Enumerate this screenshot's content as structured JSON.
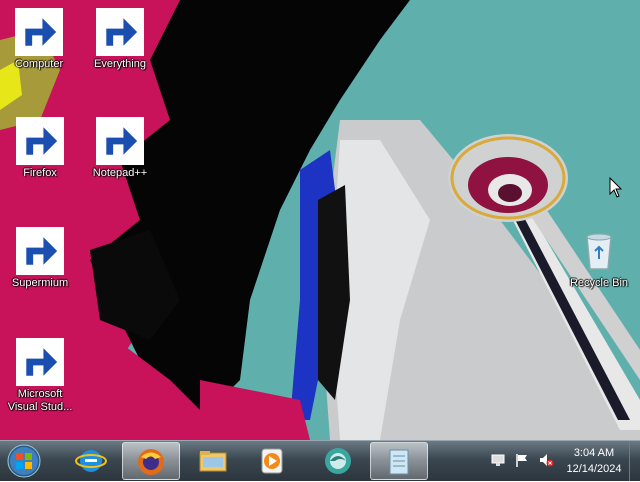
{
  "desktop": {
    "icons": [
      {
        "label": "Computer",
        "icon": "computer-icon"
      },
      {
        "label": "Everything",
        "icon": "everything-icon"
      },
      {
        "label": "Firefox",
        "icon": "firefox-icon"
      },
      {
        "label": "Notepad++",
        "icon": "notepad-plus-plus-icon"
      },
      {
        "label": "Supermium",
        "icon": "supermium-icon"
      },
      {
        "label": "Microsoft\nVisual Stud...",
        "icon": "visual-studio-icon"
      },
      {
        "label": "Recycle Bin",
        "icon": "recycle-bin-icon"
      }
    ]
  },
  "taskbar": {
    "start_icon": "windows-start-icon",
    "pinned": [
      {
        "name": "Internet Explorer",
        "icon": "internet-explorer-icon",
        "active": false
      },
      {
        "name": "Firefox",
        "icon": "firefox-icon",
        "active": true
      },
      {
        "name": "File Explorer",
        "icon": "folder-icon",
        "active": false
      },
      {
        "name": "Media Player",
        "icon": "media-player-icon",
        "active": false
      },
      {
        "name": "Supermium",
        "icon": "supermium-icon",
        "active": false
      },
      {
        "name": "Notepad",
        "icon": "notepad-icon",
        "active": true
      }
    ],
    "tray_icons": [
      "network-icon",
      "action-center-flag-icon",
      "volume-muted-icon"
    ],
    "clock": {
      "time": "3:04 AM",
      "date": "12/14/2024"
    }
  },
  "colors": {
    "wallpaper_teal": "#5fb0ac",
    "wallpaper_magenta": "#c8125a",
    "taskbar": "#3b4750"
  }
}
